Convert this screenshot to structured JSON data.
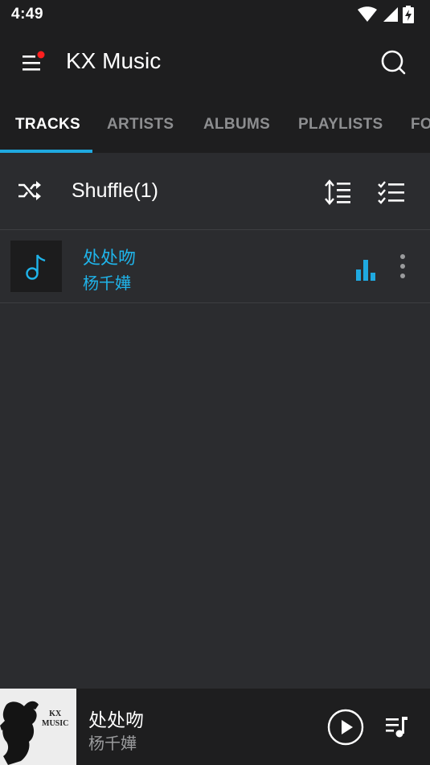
{
  "status_bar": {
    "time": "4:49",
    "icons": [
      "wifi-icon",
      "cell-signal-icon",
      "battery-charging-icon"
    ]
  },
  "app_bar": {
    "title": "KX Music",
    "menu_icon": "menu-icon",
    "notification_dot_color": "#ff1f1f",
    "search_icon": "search-icon"
  },
  "tabs": [
    {
      "label": "TRACKS",
      "active": true
    },
    {
      "label": "ARTISTS",
      "active": false
    },
    {
      "label": "ALBUMS",
      "active": false
    },
    {
      "label": "PLAYLISTS",
      "active": false
    },
    {
      "label": "FO",
      "active": false
    }
  ],
  "shuffle_bar": {
    "label": "Shuffle(1)",
    "shuffle_icon": "shuffle-icon",
    "sort_icon": "sort-icon",
    "select_icon": "checklist-icon"
  },
  "tracks": [
    {
      "title": "处处吻",
      "artist": "杨千嬅",
      "thumb_icon": "music-note-icon",
      "playing_icon": "equalizer-icon",
      "more_icon": "more-vert-icon"
    }
  ],
  "now_playing": {
    "title": "处处吻",
    "artist": "杨千嬅",
    "art_text_line1": "KX",
    "art_text_line2": "MUSIC",
    "play_icon": "play-icon",
    "queue_icon": "queue-music-icon"
  },
  "colors": {
    "accent": "#1fa9e0",
    "track_text": "#1fb4ea",
    "background": "#2b2c2f",
    "bar_background": "#1e1e1f",
    "tab_inactive": "#8d8e90"
  }
}
